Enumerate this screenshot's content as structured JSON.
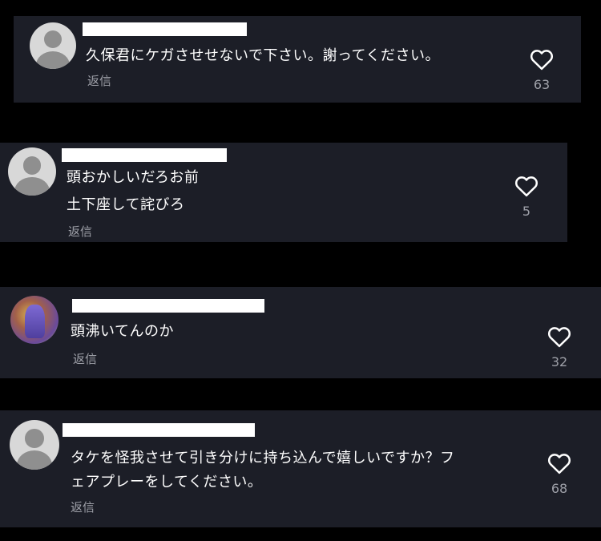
{
  "comments": [
    {
      "text_lines": [
        "久保君にケガさせせないで下さい。謝ってください。"
      ],
      "reply_label": "返信",
      "like_count": "63",
      "avatar": "default-avatar"
    },
    {
      "text_lines": [
        "頭おかしいだろお前",
        "土下座して詫びろ"
      ],
      "reply_label": "返信",
      "like_count": "5",
      "avatar": "default-avatar"
    },
    {
      "text_lines": [
        "頭沸いてんのか"
      ],
      "reply_label": "返信",
      "like_count": "32",
      "avatar": "photo-avatar"
    },
    {
      "text_lines": [
        "タケを怪我させて引き分けに持ち込んで嬉しいですか？フ",
        "ェアプレーをしてください。"
      ],
      "reply_label": "返信",
      "like_count": "68",
      "avatar": "default-avatar"
    }
  ],
  "icons": {
    "like": "heart-outline-icon"
  },
  "colors": {
    "card_bg": "#1c1e27",
    "page_bg": "#000000",
    "muted_text": "#9ea0a8"
  }
}
